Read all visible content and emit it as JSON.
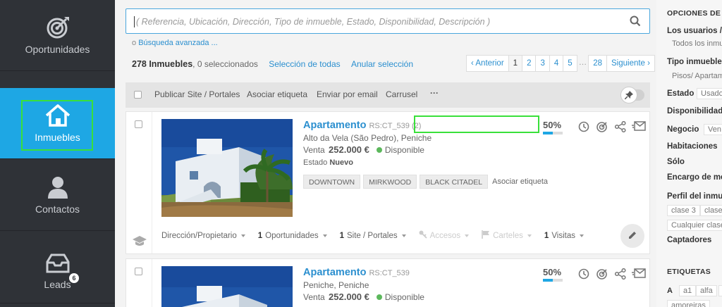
{
  "sidebar": {
    "items": [
      {
        "label": "Oportunidades",
        "icon": "target-icon"
      },
      {
        "label": "Inmuebles",
        "icon": "house-icon"
      },
      {
        "label": "Contactos",
        "icon": "person-icon"
      },
      {
        "label": "Leads",
        "icon": "inbox-icon",
        "badge": "6"
      }
    ],
    "active_color": "#1ea7e4",
    "background": "#2f3237"
  },
  "search": {
    "placeholder": "( Referencia, Ubicación, Dirección, Tipo de inmueble, Estado, Disponibilidad, Descripción )",
    "advanced_prefix": "o",
    "advanced_label": "Búsqueda avanzada ..."
  },
  "results": {
    "count_label": "278 Inmuebles",
    "selected_label": ", 0 seleccionados",
    "select_all": "Selección de todas",
    "clear_selection": "Anular selección"
  },
  "pagination": {
    "prev": "‹ Anterior",
    "pages": [
      "1",
      "2",
      "3",
      "4",
      "5"
    ],
    "ellipsis": "…",
    "last": "28",
    "next": "Siguiente ›",
    "current": "1"
  },
  "toolbar": {
    "actions": [
      "Publicar Site / Portales",
      "Asociar etiqueta",
      "Enviar por email",
      "Carrusel"
    ],
    "more": "···"
  },
  "properties": [
    {
      "type": "Apartamento",
      "ref": "RS:CT_539 (2)",
      "address": "Alto da Vela (São Pedro), Peniche",
      "price_prefix": "Venta",
      "price": "252.000 €",
      "status": "Disponible",
      "estado_label": "Estado",
      "estado_value": "Nuevo",
      "tags": [
        "DOWNTOWN",
        "MIRKWOOD",
        "BLACK CITADEL"
      ],
      "tag_add": "Asociar etiqueta",
      "completion": "50%",
      "completion_value": 0.5,
      "footer": {
        "owner": "Dirección/Propietario",
        "opportunities_count": "1",
        "opportunities": "Oportunidades",
        "sites_count": "1",
        "sites": "Site / Portales",
        "accesos": "Accesos",
        "carteles": "Carteles",
        "visits_count": "1",
        "visits": "Visitas"
      }
    },
    {
      "type": "Apartamento",
      "ref": "RS:CT_539",
      "address": "Peniche, Peniche",
      "price_prefix": "Venta",
      "price": "252.000 €",
      "status": "Disponible",
      "completion": "50%",
      "completion_value": 0.5
    }
  ],
  "right_panel": {
    "title": "OPCIONES DE B",
    "users_label": "Los usuarios /",
    "users_value": "Todos los inmu",
    "type_label": "Tipo inmueble",
    "type_value": "Pisos/ Apartam",
    "estado_label": "Estado",
    "estado_value": "Usado",
    "disponibilidad_label": "Disponibilidad",
    "negocio_label": "Negocio",
    "negocio_value": "Ven",
    "habitaciones_label": "Habitaciones",
    "solo_label": "Sólo",
    "encargo_label": "Encargo de me",
    "perfil_label": "Perfil del inmu",
    "perfil_values": [
      "clase 3",
      "clase"
    ],
    "perfil_any": "Cualquier clase",
    "captadores_label": "Captadores",
    "etiquetas_title": "ETIQUETAS",
    "etiquetas": [
      "A",
      "a1",
      "alfa",
      "a"
    ],
    "etiquetas_more": "amoreiras"
  }
}
